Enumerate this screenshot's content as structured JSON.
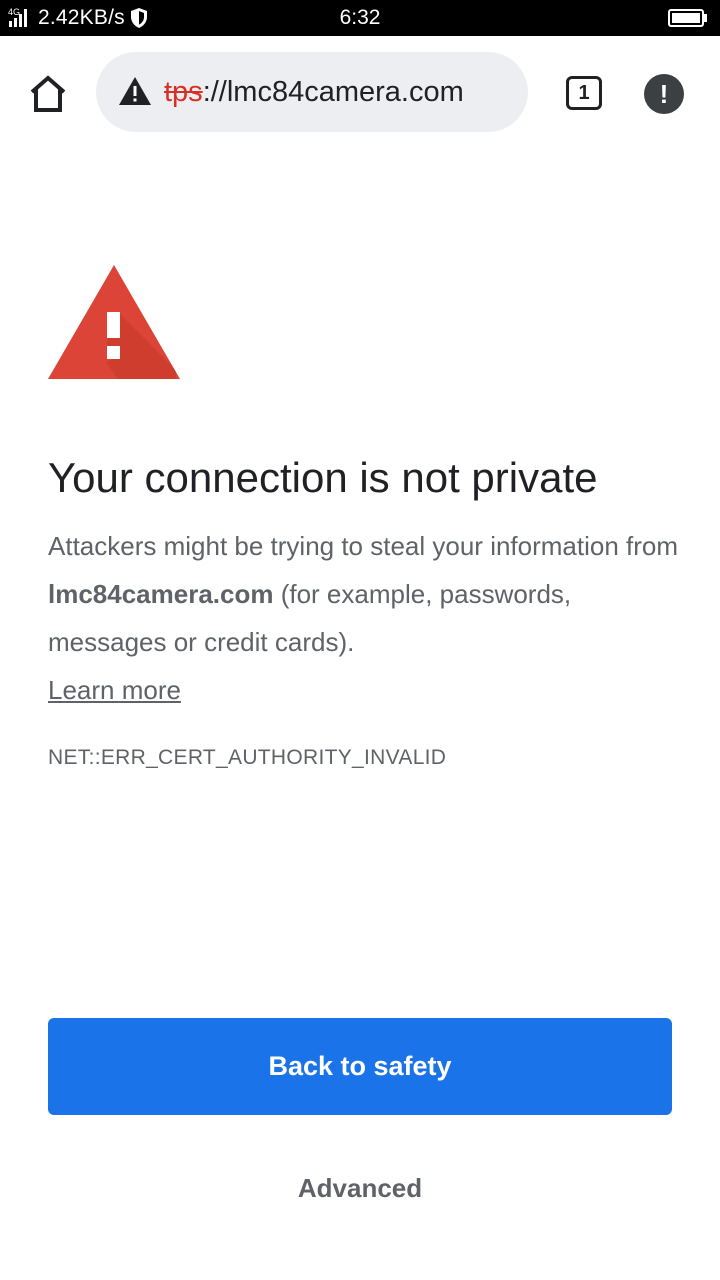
{
  "status_bar": {
    "network_type": "4G",
    "net_speed": "2.42KB/s",
    "time": "6:32"
  },
  "toolbar": {
    "url_scheme_fragment": "tps",
    "url_rest": "://lmc84camera.com",
    "tab_count": "1"
  },
  "interstitial": {
    "title": "Your connection is not private",
    "body_prefix": "Attackers might be trying to steal your information from ",
    "body_domain": "lmc84camera.com",
    "body_suffix": " (for example, passwords, messages or credit cards). ",
    "learn_more": "Learn more",
    "error_code": "NET::ERR_CERT_AUTHORITY_INVALID",
    "primary_button": "Back to safety",
    "secondary_button": "Advanced"
  },
  "colors": {
    "primary_blue": "#1a73e8",
    "warning_red": "#db4437",
    "insecure_scheme_red": "#d93025",
    "omnibox_bg": "#eceef1",
    "text_gray": "#5f6368"
  },
  "icons": {
    "signal": "signal-icon",
    "vpn_shield": "shield-icon",
    "battery": "battery-icon",
    "home": "home-icon",
    "not_secure": "warning-triangle-icon",
    "tab_switcher": "tab-switcher-icon",
    "menu": "menu-alert-icon",
    "interstitial_warning": "large-warning-icon"
  }
}
